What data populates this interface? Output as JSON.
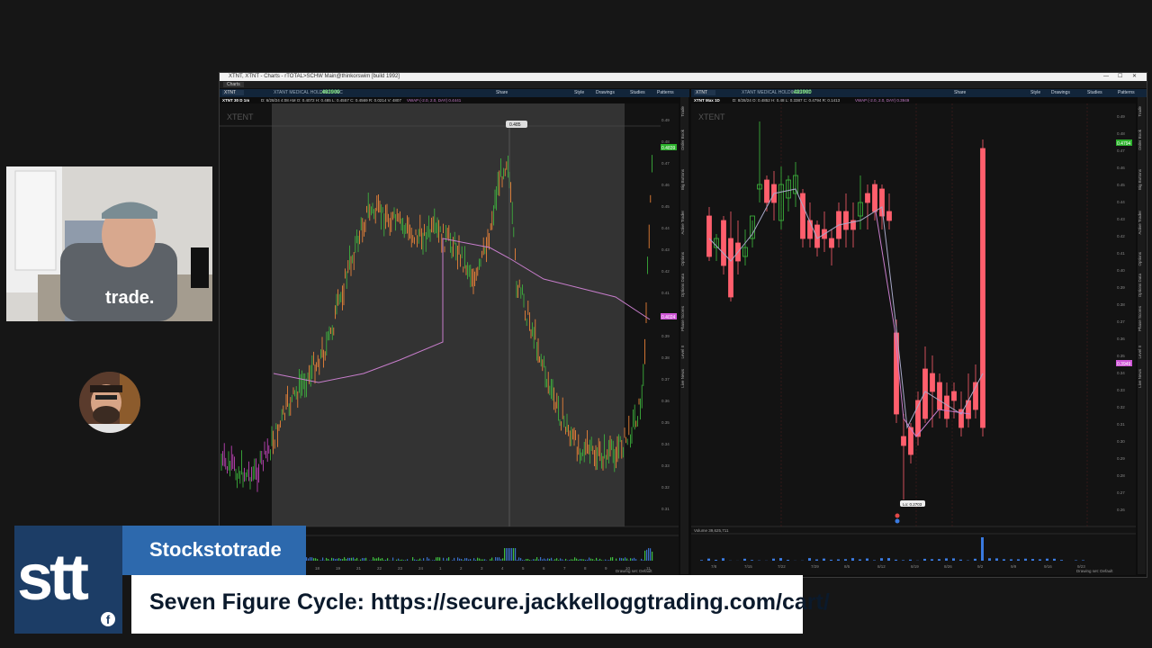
{
  "window": {
    "title": "XTNT, XTNT - Charts - rTOTAL>SCHW Main@thinkorswim [build 1992]",
    "tab_label": "Charts"
  },
  "left_chart": {
    "symbol": "XTNT",
    "company": "XTANT MEDICAL HOLDINGS INC",
    "last": ".483900",
    "toolbar_items": [
      "Share",
      "Style",
      "Drawings",
      "Studies",
      "Patterns"
    ],
    "period": "XTNT 30 D 1m",
    "ohlc": "D: 6/28/24 4:08 AM   O: 0.4072   H: 0.485   L: 0.4557   C: 0.4569   R: 0.0214   V: 4807",
    "study": "VWAP (-2.0, 2.0, DAY)  0.4441",
    "watermark": "XTENT",
    "price_ticks": [
      "0.49",
      "0.48",
      "0.47",
      "0.46",
      "0.45",
      "0.44",
      "0.43",
      "0.42",
      "0.41",
      "0.40",
      "0.39",
      "0.38",
      "0.37",
      "0.36",
      "0.35",
      "0.34",
      "0.33",
      "0.32",
      "0.31"
    ],
    "date_ticks": [
      "18",
      "19",
      "21",
      "22",
      "23",
      "24",
      "1",
      "2",
      "3",
      "4",
      "5",
      "6",
      "7",
      "8",
      "9",
      "10",
      "11"
    ],
    "marker_label": "0.485",
    "current_price_tag": "0.4839",
    "vwap_tag": "0.4024",
    "footer": "Drawing set: Default",
    "side_labels": [
      "Trade",
      "Order Book",
      "Big Buttons",
      "Active Trader",
      "Options",
      "Options Data",
      "Phase Scores",
      "Level II",
      "Live News"
    ]
  },
  "right_chart": {
    "symbol": "XTNT",
    "company": "XTANT MEDICAL HOLDINGS INC",
    "last": ".483900",
    "toolbar_items": [
      "Share",
      "Style",
      "Drawings",
      "Studies",
      "Patterns"
    ],
    "period": "XTNT Max 1D",
    "ohlc": "D: 8/28/24   O: 0.4852   H: 0.48   L: 0.3387   C: 0.4794   R: 0.1413",
    "study": "VWAP (-2.0, 2.0, DAY)  0.3949",
    "watermark": "XTENT",
    "price_ticks": [
      "0.49",
      "0.48",
      "0.47",
      "0.46",
      "0.45",
      "0.44",
      "0.43",
      "0.42",
      "0.41",
      "0.40",
      "0.39",
      "0.38",
      "0.37",
      "0.36",
      "0.35",
      "0.34",
      "0.33",
      "0.32",
      "0.31",
      "0.30",
      "0.29",
      "0.28",
      "0.27",
      "0.26"
    ],
    "date_ticks": [
      "7/8",
      "7/15",
      "7/22",
      "7/29",
      "8/5",
      "8/12",
      "8/19",
      "8/26",
      "9/2",
      "9/9",
      "9/16",
      "9/23"
    ],
    "low_label": "Lo: 0.2703",
    "current_price_tag": "0.4794",
    "vwap_tag": "0.3949",
    "volume_label": "Volume  39,625,711",
    "footer": "Drawing set: Default",
    "side_labels": [
      "Trade",
      "Order Book",
      "Big Buttons",
      "Active Trader",
      "Options",
      "Options Data",
      "Phase Scores",
      "Level II",
      "Live News"
    ]
  },
  "overlay": {
    "logo_text": "stt",
    "facebook_icon": "f",
    "name": "Stockstotrade",
    "message": "Seven Figure Cycle: https://secure.jackkelloggtrading.com/cart/"
  },
  "webcam": {
    "shirt_text": "trade."
  },
  "colors": {
    "up": "#3fbf3f",
    "down": "#ff5f6d",
    "vwap": "#c77dcb",
    "brand_dark": "#1c3d66",
    "brand_blue": "#2d69ad"
  }
}
